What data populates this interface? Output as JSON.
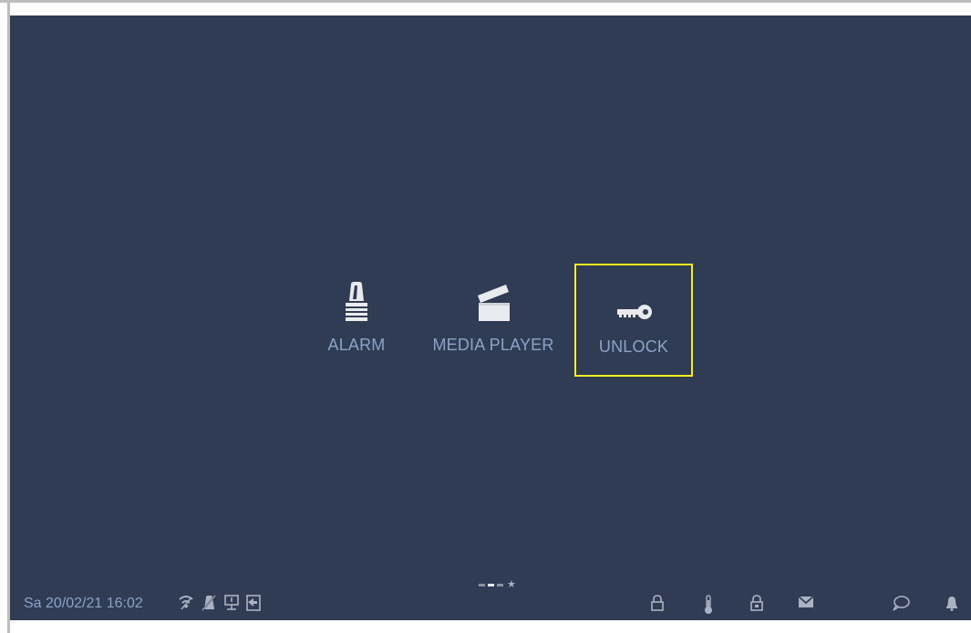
{
  "tiles": [
    {
      "label": "ALARM",
      "icon": "alarm-siren-icon"
    },
    {
      "label": "MEDIA PLAYER",
      "icon": "clapperboard-icon"
    },
    {
      "label": "UNLOCK",
      "icon": "key-icon",
      "selected": true
    }
  ],
  "pager": {
    "pages": 3,
    "active_page": 2,
    "favorites": "star-icon"
  },
  "statusbar": {
    "datetime": "Sa 20/02/21  16:02",
    "left_icons": [
      "wifi-icon",
      "mute-icon",
      "network-icon",
      "door-icon"
    ],
    "right_icons": [
      "lock-icon",
      "thermometer-icon",
      "security-lock-icon",
      "mail-icon",
      "chat-icon",
      "bell-icon"
    ]
  },
  "colors": {
    "background": "#2f3c54",
    "label": "#8ba3c7",
    "highlight": "#f4ee1f"
  }
}
